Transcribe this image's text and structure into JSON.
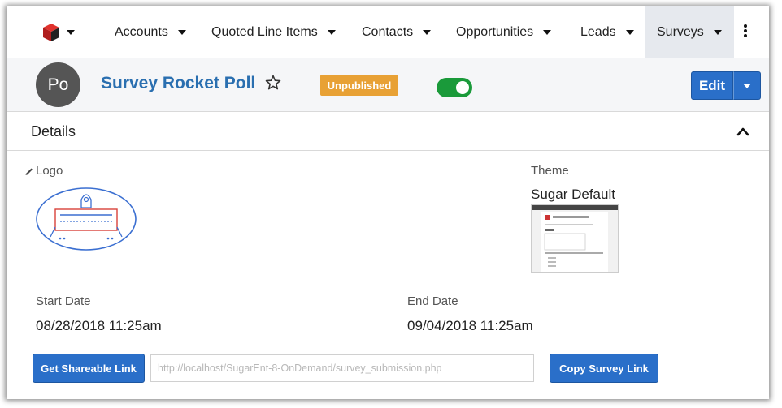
{
  "nav": {
    "items": [
      {
        "label": "Accounts"
      },
      {
        "label": "Quoted Line Items"
      },
      {
        "label": "Contacts"
      },
      {
        "label": "Opportunities"
      },
      {
        "label": "Leads"
      },
      {
        "label": "Surveys"
      }
    ],
    "active": "Surveys"
  },
  "record": {
    "avatar_initials": "Po",
    "title": "Survey Rocket Poll",
    "status_badge": "Unpublished",
    "toggle_on": true,
    "edit_label": "Edit"
  },
  "panel": {
    "title": "Details"
  },
  "fields": {
    "logo_label": "Logo",
    "theme_label": "Theme",
    "theme_value": "Sugar Default",
    "start_label": "Start Date",
    "start_value": "08/28/2018 11:25am",
    "end_label": "End Date",
    "end_value": "09/04/2018 11:25am"
  },
  "actions": {
    "get_link_label": "Get Shareable Link",
    "link_value": "http://localhost/SugarEnt-8-OnDemand/survey_submission.php",
    "copy_link_label": "Copy Survey Link"
  },
  "colors": {
    "primary": "#2a6fc9",
    "badge": "#e8a135",
    "toggle": "#1a9a3a",
    "title_link": "#2a6fb0"
  }
}
